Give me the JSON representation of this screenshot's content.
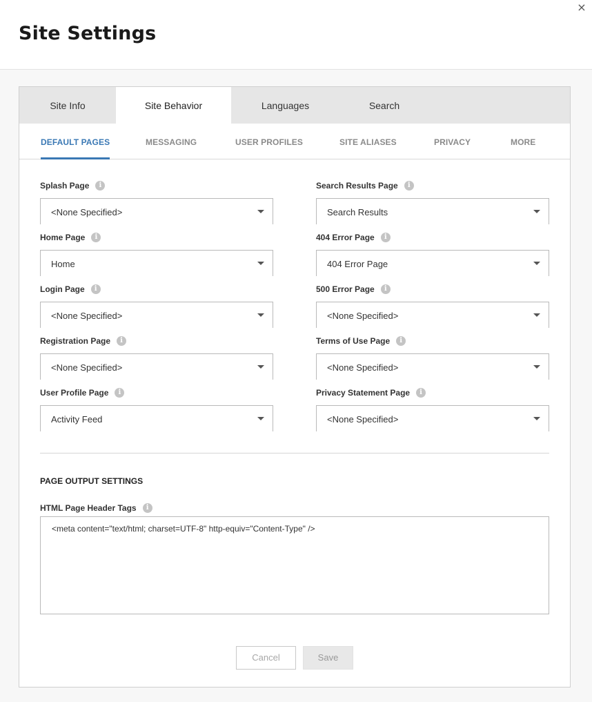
{
  "header": {
    "title": "Site Settings",
    "close_glyph": "×"
  },
  "tabs": [
    {
      "label": "Site Info",
      "active": false
    },
    {
      "label": "Site Behavior",
      "active": true
    },
    {
      "label": "Languages",
      "active": false
    },
    {
      "label": "Search",
      "active": false
    }
  ],
  "subtabs": [
    {
      "label": "DEFAULT PAGES",
      "active": true
    },
    {
      "label": "MESSAGING",
      "active": false
    },
    {
      "label": "USER PROFILES",
      "active": false
    },
    {
      "label": "SITE ALIASES",
      "active": false
    },
    {
      "label": "PRIVACY",
      "active": false
    },
    {
      "label": "MORE",
      "active": false
    }
  ],
  "fields": {
    "splash": {
      "label": "Splash Page",
      "value": "<None Specified>"
    },
    "home": {
      "label": "Home Page",
      "value": "Home"
    },
    "login": {
      "label": "Login Page",
      "value": "<None Specified>"
    },
    "registration": {
      "label": "Registration Page",
      "value": "<None Specified>"
    },
    "user_profile": {
      "label": "User Profile Page",
      "value": "Activity Feed"
    },
    "search_results": {
      "label": "Search Results Page",
      "value": "Search Results"
    },
    "error_404": {
      "label": "404 Error Page",
      "value": "404 Error Page"
    },
    "error_500": {
      "label": "500 Error Page",
      "value": "<None Specified>"
    },
    "terms": {
      "label": "Terms of Use Page",
      "value": "<None Specified>"
    },
    "privacy": {
      "label": "Privacy Statement Page",
      "value": "<None Specified>"
    }
  },
  "info_glyph": "i",
  "output": {
    "section_title": "PAGE OUTPUT SETTINGS",
    "header_tags_label": "HTML Page Header Tags",
    "header_tags_value": "<meta content=\"text/html; charset=UTF-8\" http-equiv=\"Content-Type\" />"
  },
  "buttons": {
    "cancel": "Cancel",
    "save": "Save"
  },
  "colors": {
    "accent": "#3a78b4",
    "tab_bar": "#e6e6e6",
    "info_icon": "#c4c4c4"
  }
}
